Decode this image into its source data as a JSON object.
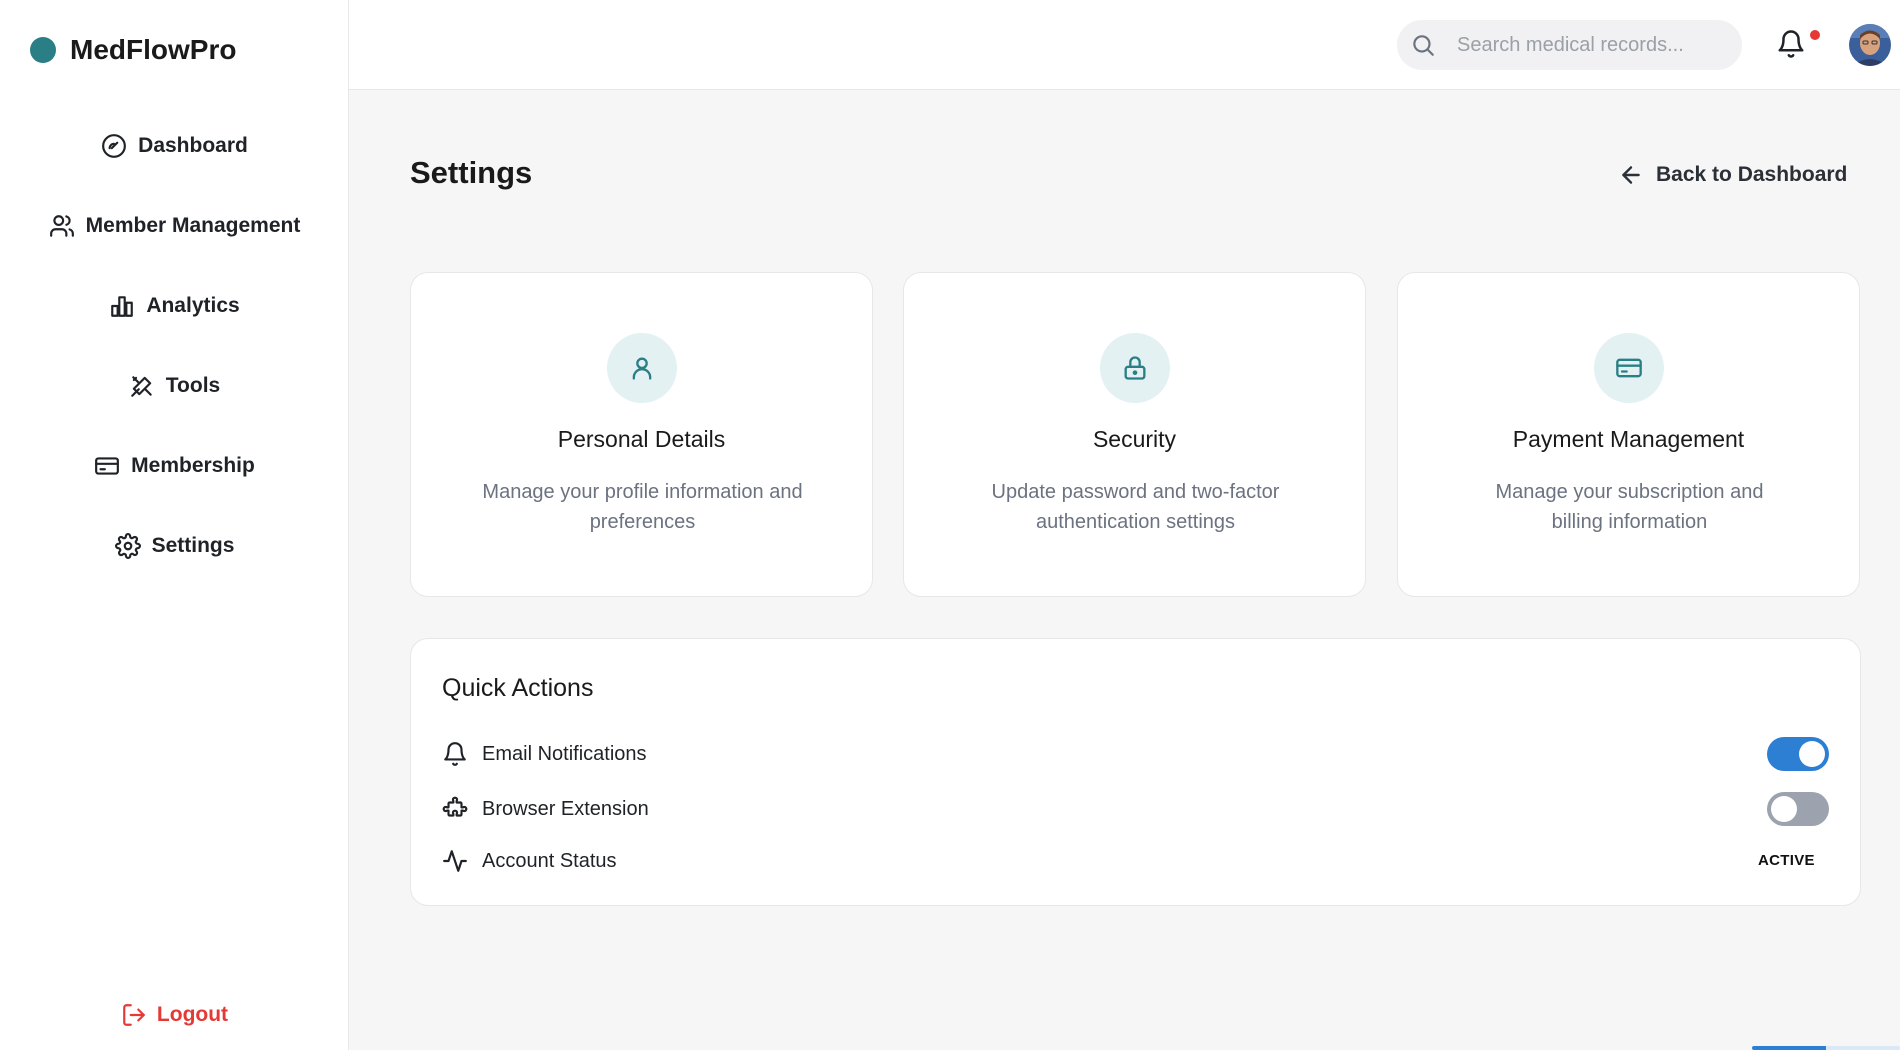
{
  "brand": {
    "name": "MedFlowPro",
    "color": "#2a7f86"
  },
  "sidebar": {
    "items": [
      {
        "label": "Dashboard",
        "icon": "dashboard-gauge-icon"
      },
      {
        "label": "Member Management",
        "icon": "users-icon"
      },
      {
        "label": "Analytics",
        "icon": "bar-chart-icon"
      },
      {
        "label": "Tools",
        "icon": "tools-icon"
      },
      {
        "label": "Membership",
        "icon": "credit-card-icon"
      },
      {
        "label": "Settings",
        "icon": "gear-icon"
      }
    ],
    "logout": {
      "label": "Logout",
      "icon": "logout-icon",
      "color": "#e53935"
    }
  },
  "topbar": {
    "search": {
      "placeholder": "Search medical records..."
    },
    "notifications": {
      "icon": "bell-icon",
      "has_unread": true
    },
    "avatar": {
      "icon": "avatar"
    }
  },
  "page": {
    "title": "Settings",
    "back_label": "Back to Dashboard"
  },
  "cards": [
    {
      "title": "Personal Details",
      "description": "Manage your profile information and preferences",
      "icon": "user-icon"
    },
    {
      "title": "Security",
      "description": "Update password and two-factor authentication settings",
      "icon": "lock-icon"
    },
    {
      "title": "Payment Management",
      "description": "Manage your subscription and billing information",
      "icon": "credit-card-icon"
    }
  ],
  "quick_actions": {
    "title": "Quick Actions",
    "items": [
      {
        "label": "Email Notifications",
        "icon": "bell-icon",
        "toggle": true
      },
      {
        "label": "Browser Extension",
        "icon": "puzzle-icon",
        "toggle": false
      },
      {
        "label": "Account Status",
        "icon": "activity-icon",
        "status": "ACTIVE"
      }
    ]
  },
  "colors": {
    "accent": "#2a7f86",
    "toggle_on": "#2d7fd3",
    "toggle_off": "#9ca3af",
    "danger": "#e53935"
  }
}
